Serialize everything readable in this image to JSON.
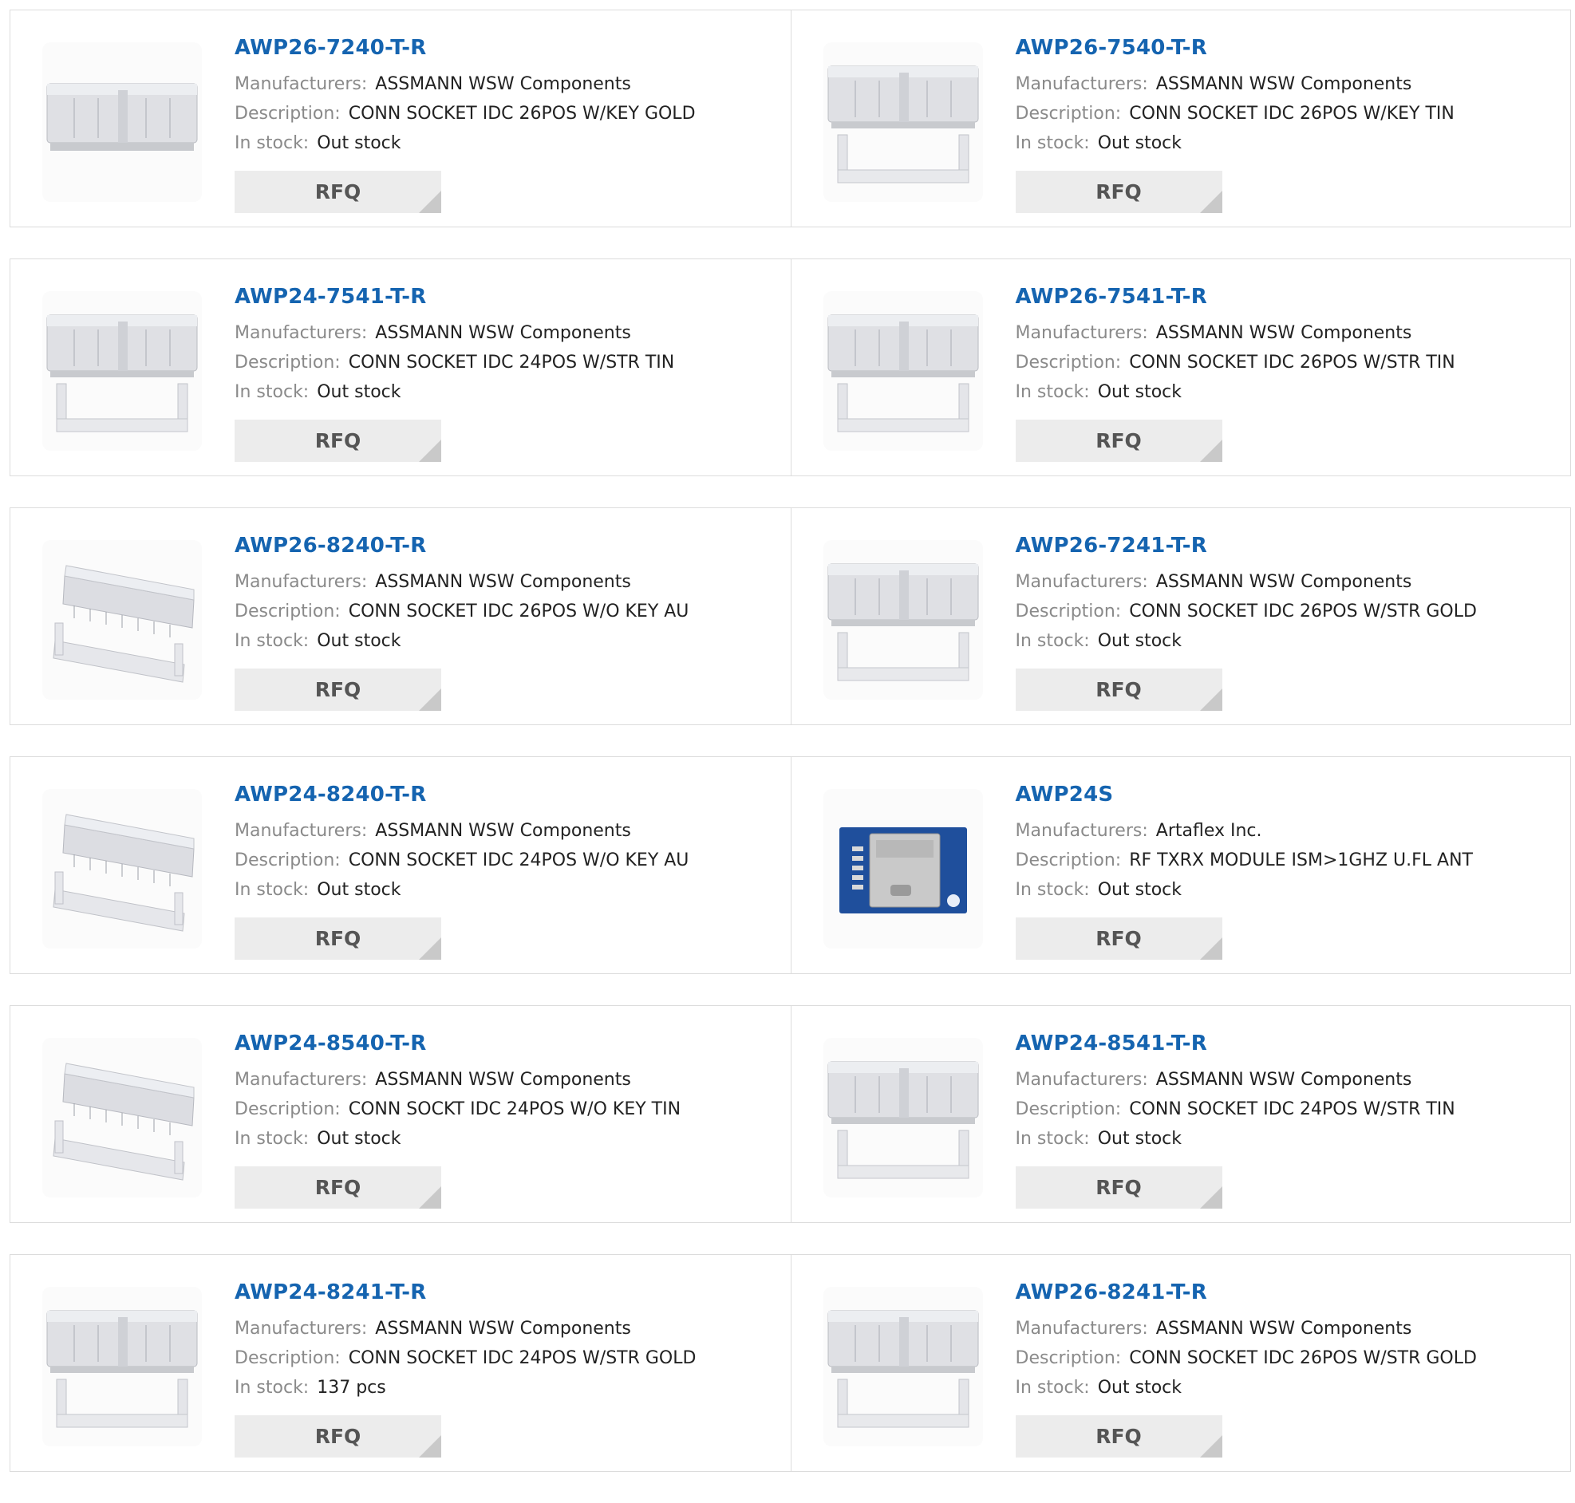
{
  "labels": {
    "manufacturers": "Manufacturers:",
    "description": "Description:",
    "in_stock": "In stock:",
    "rfq": "RFQ"
  },
  "colors": {
    "title": "#1564b0",
    "button_bg": "#ececec",
    "border": "#dcdcdc"
  },
  "products": [
    {
      "part": "AWP26-7240-T-R",
      "manufacturer": "ASSMANN WSW Components",
      "description": "CONN SOCKET IDC 26POS W/KEY GOLD",
      "stock": "Out stock",
      "image": "idc-socket-icon"
    },
    {
      "part": "AWP26-7540-T-R",
      "manufacturer": "ASSMANN WSW Components",
      "description": "CONN SOCKET IDC 26POS W/KEY TIN",
      "stock": "Out stock",
      "image": "idc-socket-with-strain-relief-icon"
    },
    {
      "part": "AWP24-7541-T-R",
      "manufacturer": "ASSMANN WSW Components",
      "description": "CONN SOCKET IDC 24POS W/STR TIN",
      "stock": "Out stock",
      "image": "idc-socket-with-strain-relief-icon"
    },
    {
      "part": "AWP26-7541-T-R",
      "manufacturer": "ASSMANN WSW Components",
      "description": "CONN SOCKET IDC 26POS W/STR TIN",
      "stock": "Out stock",
      "image": "idc-socket-with-strain-relief-icon"
    },
    {
      "part": "AWP26-8240-T-R",
      "manufacturer": "ASSMANN WSW Components",
      "description": "CONN SOCKET IDC 26POS W/O KEY AU",
      "stock": "Out stock",
      "image": "idc-socket-angled-icon"
    },
    {
      "part": "AWP26-7241-T-R",
      "manufacturer": "ASSMANN WSW Components",
      "description": "CONN SOCKET IDC 26POS W/STR GOLD",
      "stock": "Out stock",
      "image": "idc-socket-with-strain-relief-icon"
    },
    {
      "part": "AWP24-8240-T-R",
      "manufacturer": "ASSMANN WSW Components",
      "description": "CONN SOCKET IDC 24POS W/O KEY AU",
      "stock": "Out stock",
      "image": "idc-socket-angled-icon"
    },
    {
      "part": "AWP24S",
      "manufacturer": "Artaflex Inc.",
      "description": "RF TXRX MODULE ISM>1GHZ U.FL ANT",
      "stock": "Out stock",
      "image": "rf-module-board-icon"
    },
    {
      "part": "AWP24-8540-T-R",
      "manufacturer": "ASSMANN WSW Components",
      "description": "CONN SOCKT IDC 24POS W/O KEY TIN",
      "stock": "Out stock",
      "image": "idc-socket-angled-icon"
    },
    {
      "part": "AWP24-8541-T-R",
      "manufacturer": "ASSMANN WSW Components",
      "description": "CONN SOCKET IDC 24POS W/STR TIN",
      "stock": "Out stock",
      "image": "idc-socket-with-strain-relief-icon"
    },
    {
      "part": "AWP24-8241-T-R",
      "manufacturer": "ASSMANN WSW Components",
      "description": "CONN SOCKET IDC 24POS W/STR GOLD",
      "stock": "137 pcs",
      "image": "idc-socket-with-strain-relief-icon"
    },
    {
      "part": "AWP26-8241-T-R",
      "manufacturer": "ASSMANN WSW Components",
      "description": "CONN SOCKET IDC 26POS W/STR GOLD",
      "stock": "Out stock",
      "image": "idc-socket-with-strain-relief-icon"
    }
  ]
}
